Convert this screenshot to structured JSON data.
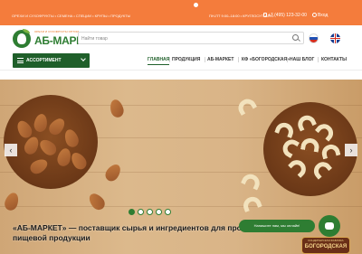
{
  "topbar": {
    "tagline": "ОРЕХИ И СУХОФРУКТЫ • СЕМЕНА • СПЕЦИИ • КРУПЫ • ПРОДУКТЫ",
    "hours": "ПН-ПТ 9:00–18:00 • КРУГЛОСУТОЧНО",
    "phone": "+7 (495) 123-32-00",
    "login": "Вход"
  },
  "logo": {
    "subtitle": "ОРЕХИ И СУХОФРУКТЫ ОПТОМ",
    "name": "АБ-МАРКЕТ"
  },
  "search": {
    "placeholder": "Найти товар"
  },
  "assortment": {
    "label": "АССОРТИМЕНТ"
  },
  "nav": {
    "items": [
      "ГЛАВНАЯ",
      "ПРОДУКЦИЯ",
      "АБ-МАРКЕТ",
      "КФ «БОГОРОДСКАЯ»",
      "НАШ БЛОГ",
      "КОНТАКТЫ"
    ]
  },
  "banner": {
    "prev": "‹",
    "next": "›",
    "headline": "«АБ-МАРКЕТ» — поставщик сырья и ингредиентов для производства пищевой продукции"
  },
  "chat": {
    "prompt": "Напишите нам, мы онлайн!"
  },
  "badge": {
    "small": "КОНДИТЕРСКАЯ ФАБРИКА",
    "big": "БОГОРОДСКАЯ"
  },
  "colors": {
    "accent": "#f47c3c",
    "brand": "#2e7d32",
    "dark_green": "#1f5f2a"
  }
}
